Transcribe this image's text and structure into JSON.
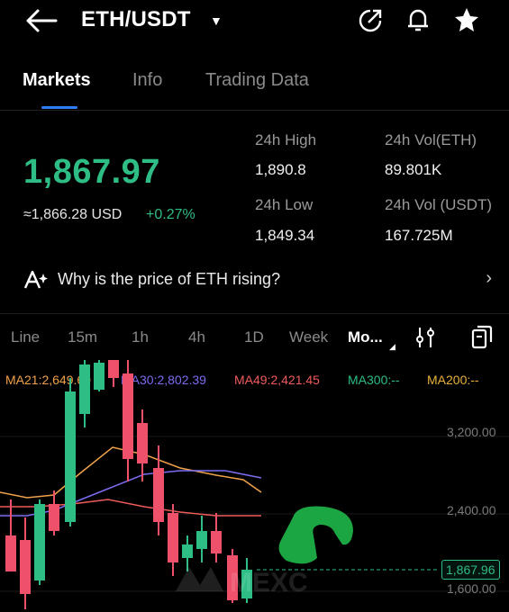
{
  "header": {
    "pair": "ETH/USDT",
    "icons": [
      "back-arrow-icon",
      "caret-down-icon",
      "share-icon",
      "bell-icon",
      "star-icon"
    ]
  },
  "tabs": [
    "Markets",
    "Info",
    "Trading Data"
  ],
  "ticker": {
    "price": "1,867.97",
    "approx_usd": "≈1,866.28 USD",
    "change": "+0.27%",
    "high_label": "24h High",
    "high_value": "1,890.8",
    "low_label": "24h Low",
    "low_value": "1,849.34",
    "vol_eth_label": "24h Vol(ETH)",
    "vol_eth_value": "89.801K",
    "vol_usdt_label": "24h Vol (USDT)",
    "vol_usdt_value": "167.725M"
  },
  "insight": {
    "text": "Why is the price of ETH rising?"
  },
  "timeframes": [
    "Line",
    "15m",
    "1h",
    "4h",
    "1D",
    "Week",
    "Mo..."
  ],
  "ma": [
    {
      "text": "MA21:2,649.60",
      "color": "#f0a24a"
    },
    {
      "text": "MA30:2,802.39",
      "color": "#7b6cf0"
    },
    {
      "text": "MA49:2,421.45",
      "color": "#ef5b5b"
    },
    {
      "text": "MA300:--",
      "color": "#2ebd85"
    },
    {
      "text": "MA200:--",
      "color": "#e8b13a"
    }
  ],
  "axis": [
    "3,200.00",
    "2,400.00",
    "1,600.00"
  ],
  "last_price": "1,867.96",
  "colors": {
    "up": "#2ebd85",
    "down": "#f0516a",
    "accent": "#2f7df6"
  }
}
